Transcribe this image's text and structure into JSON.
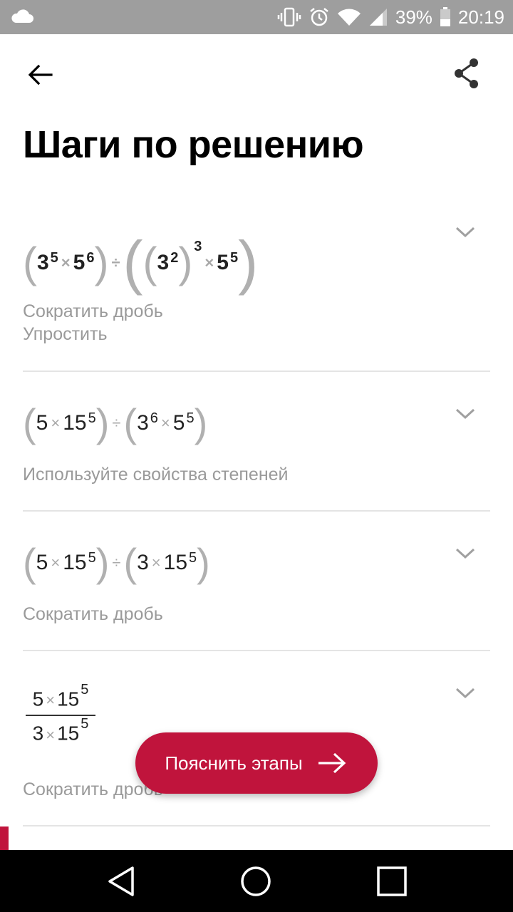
{
  "status_bar": {
    "battery": "39%",
    "time": "20:19",
    "icons": [
      "cloud-icon",
      "vibrate-icon",
      "alarm-icon",
      "wifi-icon",
      "signal-icon",
      "battery-icon"
    ]
  },
  "app_bar": {
    "back_icon": "arrow-left-icon",
    "share_icon": "share-icon"
  },
  "title": "Шаги по решению",
  "steps": [
    {
      "expression": {
        "b1": "3",
        "e1": "5",
        "b2": "5",
        "e2": "6",
        "b3": "3",
        "e3": "2",
        "e3outer": "3",
        "b4": "5",
        "e4": "5"
      },
      "hints": [
        "Сократить дробь",
        "Упростить"
      ]
    },
    {
      "expression": {
        "a": "5",
        "b": "15",
        "e1": "5",
        "c": "3",
        "e2": "6",
        "d": "5",
        "e3": "5"
      },
      "hints": [
        "Используйте свойства степеней"
      ]
    },
    {
      "expression": {
        "a": "5",
        "b": "15",
        "e1": "5",
        "c": "3",
        "d": "15",
        "e2": "5"
      },
      "hints": [
        "Сократить дробь"
      ]
    },
    {
      "expression": {
        "num_a": "5",
        "num_b": "15",
        "num_e": "5",
        "den_a": "3",
        "den_b": "15",
        "den_e": "5"
      },
      "hints": [
        "Сократить дробь"
      ]
    }
  ],
  "symbols": {
    "times": "×",
    "divide": "÷",
    "lparen": "(",
    "rparen": ")"
  },
  "fab": {
    "label": "Пояснить этапы",
    "icon": "arrow-right-icon"
  },
  "nav_bar": {
    "icons": [
      "back-triangle-icon",
      "home-circle-icon",
      "recents-square-icon"
    ]
  },
  "colors": {
    "accent": "#c0143c",
    "status_bar": "#9e9e9e",
    "hint_text": "#9a9a9a",
    "divider": "#e4e4e4"
  }
}
